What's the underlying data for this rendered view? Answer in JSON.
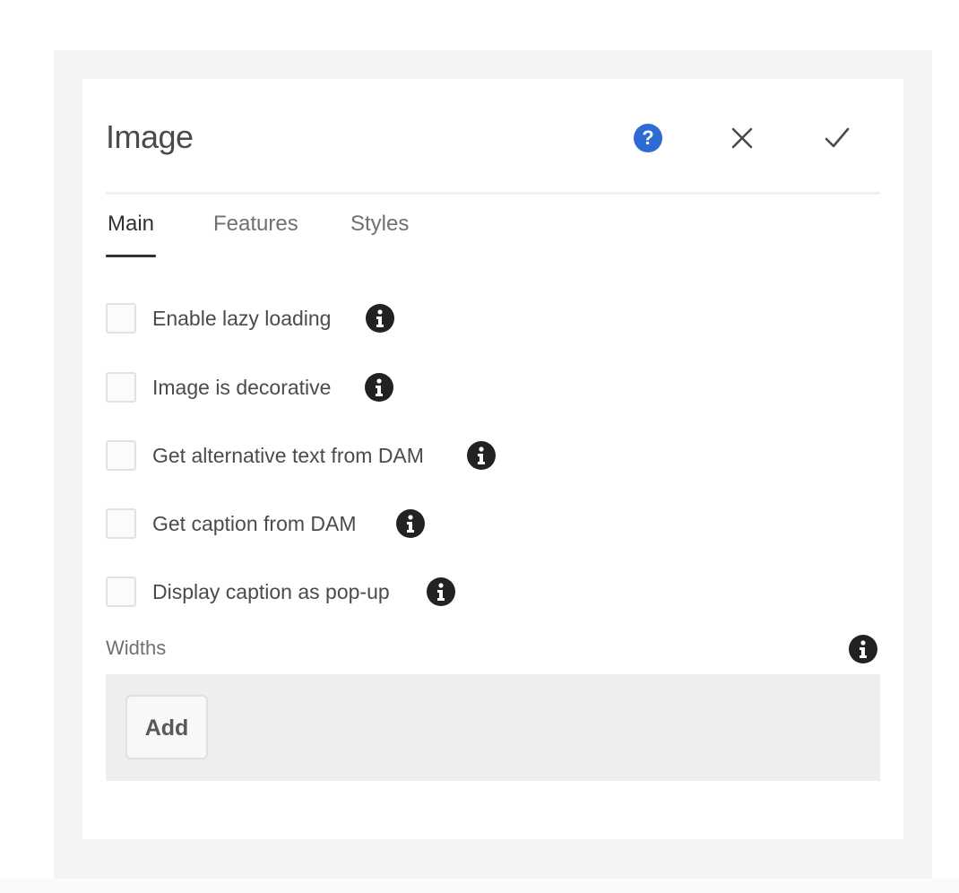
{
  "dialog": {
    "title": "Image",
    "icons": {
      "help": "help-icon",
      "close": "close-icon",
      "confirm": "checkmark-icon"
    },
    "accent_color": "#2d6ad3"
  },
  "tabs": [
    {
      "label": "Main",
      "active": true
    },
    {
      "label": "Features",
      "active": false
    },
    {
      "label": "Styles",
      "active": false
    }
  ],
  "checkboxes": [
    {
      "label": "Enable lazy loading",
      "checked": false
    },
    {
      "label": "Image is decorative",
      "checked": false
    },
    {
      "label": "Get alternative text from DAM",
      "checked": false
    },
    {
      "label": "Get caption from DAM",
      "checked": false
    },
    {
      "label": "Display caption as pop-up",
      "checked": false
    }
  ],
  "widths": {
    "label": "Widths",
    "add_label": "Add"
  }
}
